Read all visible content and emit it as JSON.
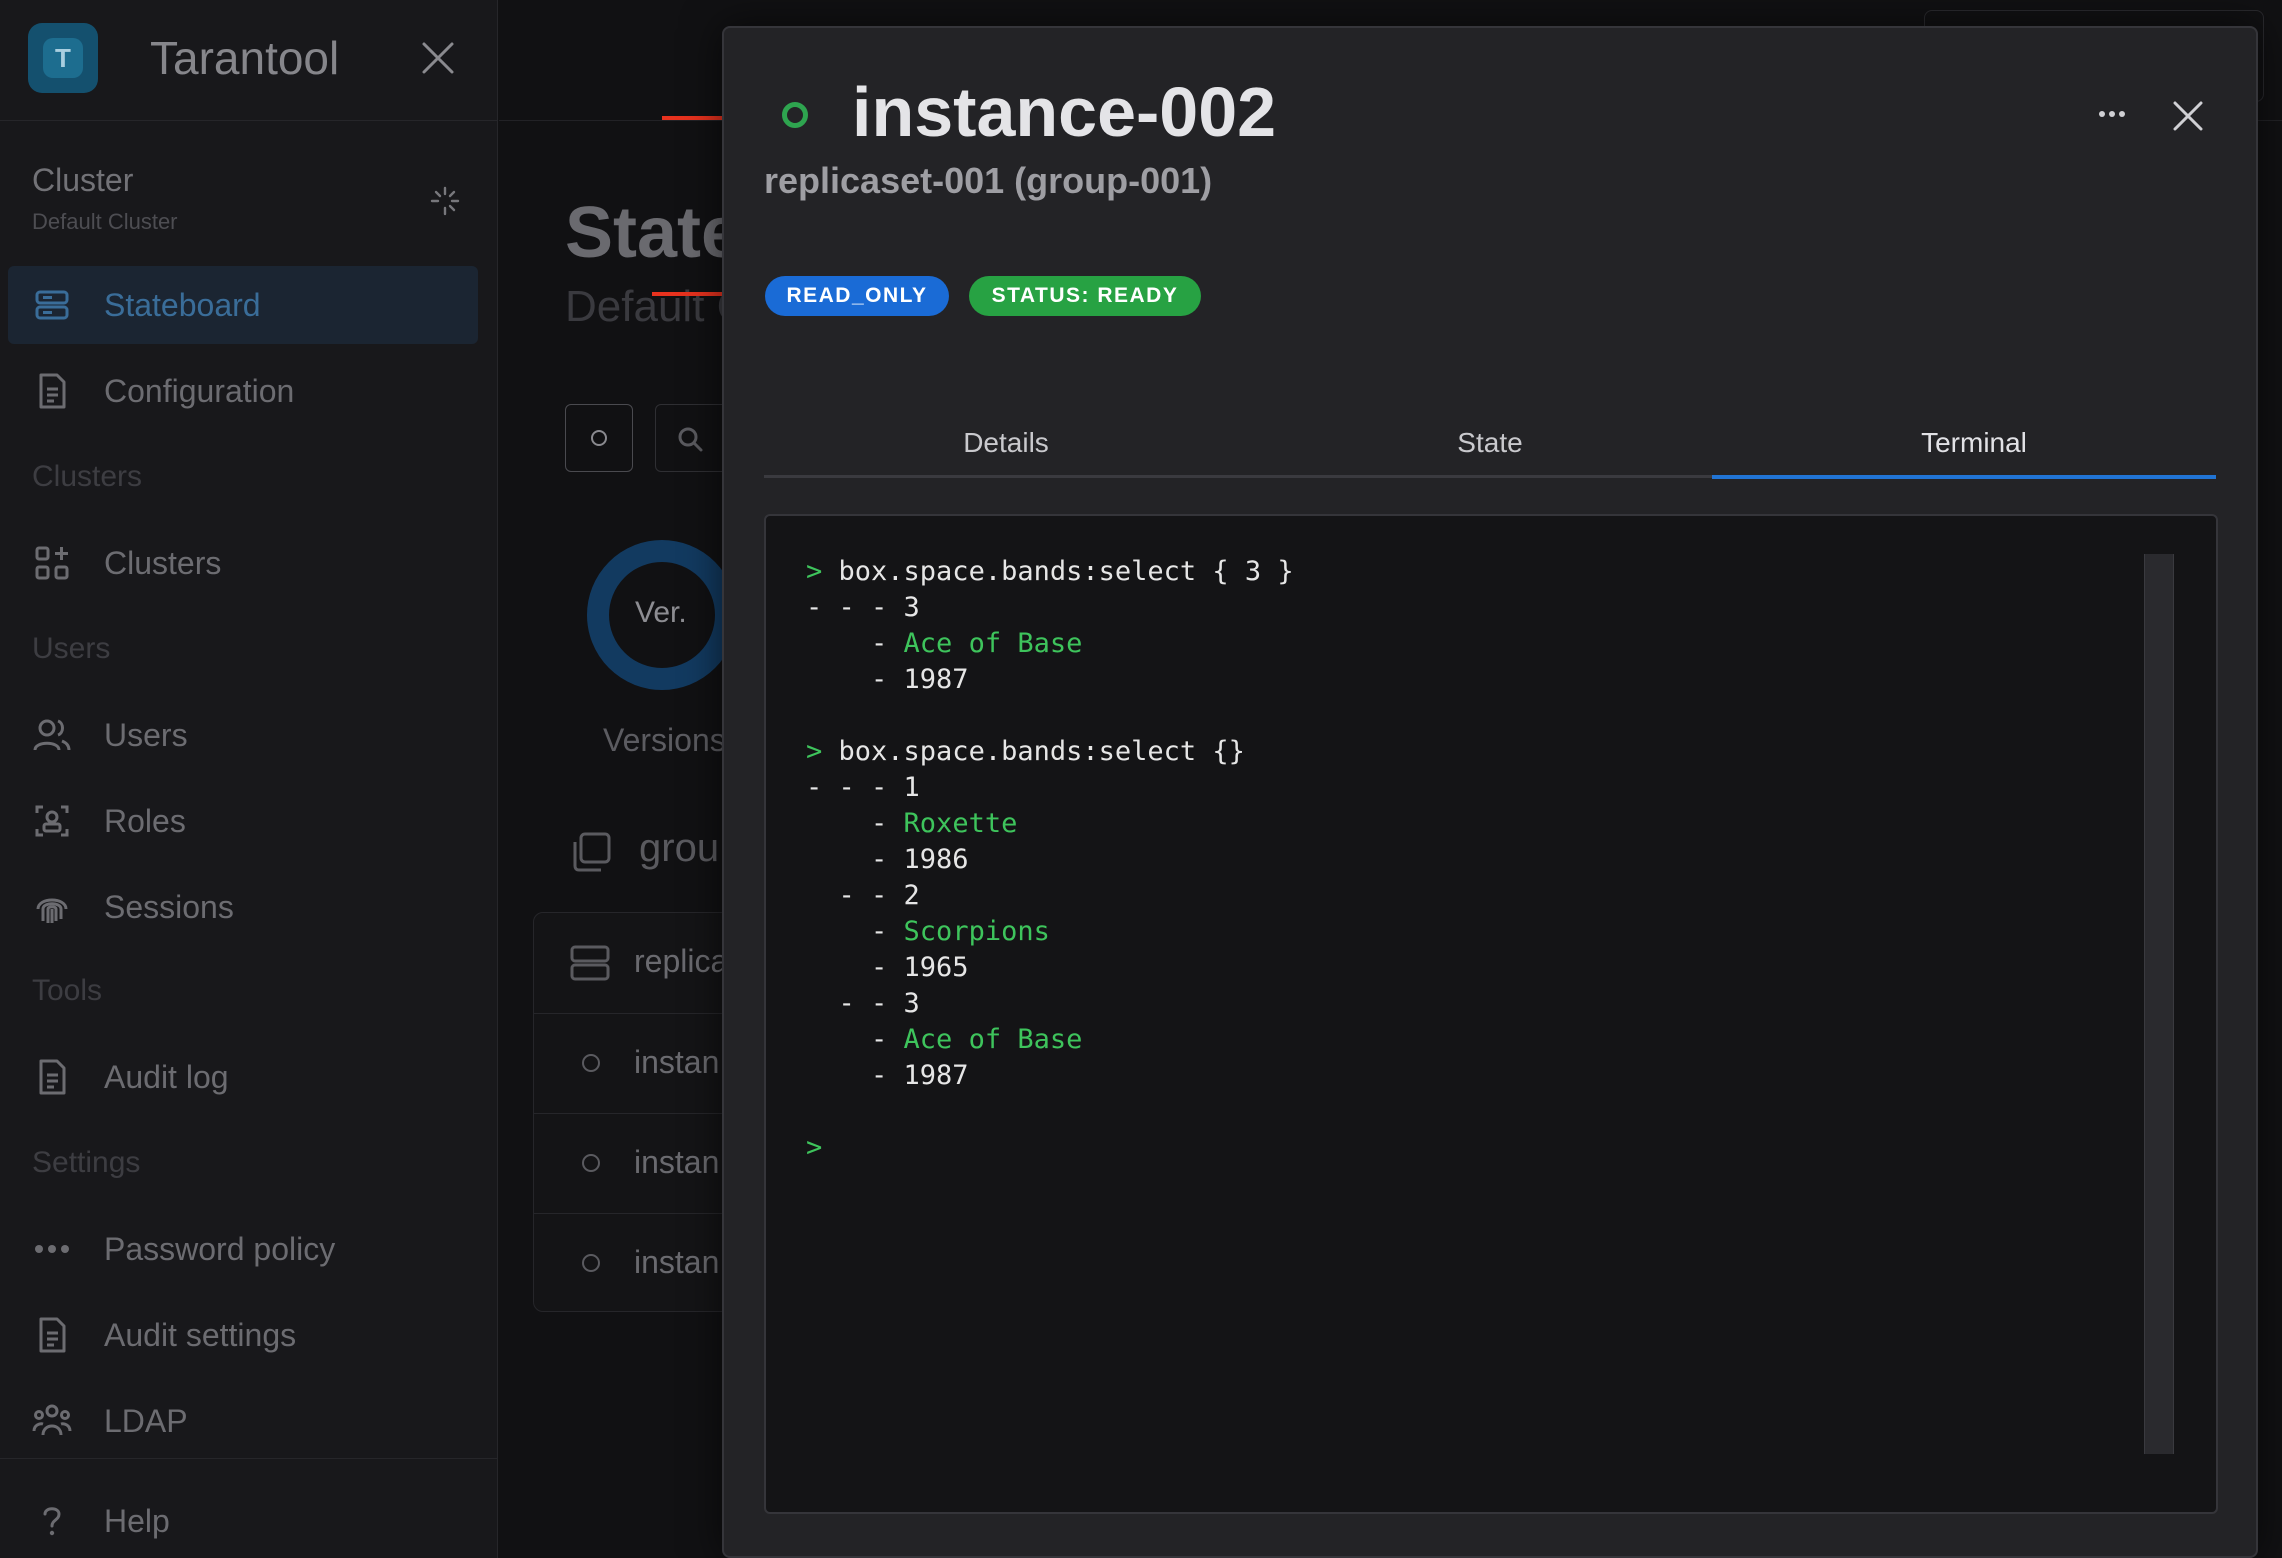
{
  "brand": {
    "name": "Tarantool",
    "logo_letter": "T"
  },
  "cluster": {
    "title": "Cluster",
    "subtitle": "Default Cluster"
  },
  "sidebar": {
    "items": [
      {
        "label": "Stateboard",
        "icon": "server-icon",
        "active": true
      },
      {
        "label": "Configuration",
        "icon": "document-icon"
      },
      {
        "section": "Clusters"
      },
      {
        "label": "Clusters",
        "icon": "widgets-icon"
      },
      {
        "section": "Users"
      },
      {
        "label": "Users",
        "icon": "users-icon"
      },
      {
        "label": "Roles",
        "icon": "role-badge-icon"
      },
      {
        "label": "Sessions",
        "icon": "fingerprint-icon"
      },
      {
        "section": "Tools"
      },
      {
        "label": "Audit log",
        "icon": "document-icon"
      },
      {
        "section": "Settings"
      },
      {
        "label": "Password policy",
        "icon": "password-dots-icon"
      },
      {
        "label": "Audit settings",
        "icon": "document-icon"
      },
      {
        "label": "LDAP",
        "icon": "group-icon"
      }
    ],
    "help": "Help"
  },
  "background_page": {
    "title": "State",
    "subtitle": "Default C",
    "ring_label": "Ver.",
    "versions_label": "Versions",
    "group_label": "grou",
    "rows": [
      "replica",
      "instan",
      "instan",
      "instan"
    ]
  },
  "modal": {
    "instance_name": "instance-002",
    "replicaset": "replicaset-001 (group-001)",
    "badges": {
      "mode": "READ_ONLY",
      "status": "STATUS: READY"
    },
    "tabs": [
      "Details",
      "State",
      "Terminal"
    ],
    "active_tab": "Terminal",
    "colors": {
      "status": "#2ea44f",
      "read_only": "#1a6bd6",
      "ready": "#27a243",
      "accent": "#2174d4"
    }
  },
  "terminal": {
    "lines": [
      {
        "prompt": ">",
        "text": " box.space.bands:select { 3 }"
      },
      {
        "text": "- - - 3"
      },
      {
        "text": "    - ",
        "green": "Ace of Base"
      },
      {
        "text": "    - 1987"
      },
      {
        "text": ""
      },
      {
        "prompt": ">",
        "text": " box.space.bands:select {}"
      },
      {
        "text": "- - - 1"
      },
      {
        "text": "    - ",
        "green": "Roxette"
      },
      {
        "text": "    - 1986"
      },
      {
        "text": "  - - 2"
      },
      {
        "text": "    - ",
        "green": "Scorpions"
      },
      {
        "text": "    - 1965"
      },
      {
        "text": "  - - 3"
      },
      {
        "text": "    - ",
        "green": "Ace of Base"
      },
      {
        "text": "    - 1987"
      },
      {
        "text": ""
      },
      {
        "prompt": ">",
        "text": ""
      }
    ]
  }
}
